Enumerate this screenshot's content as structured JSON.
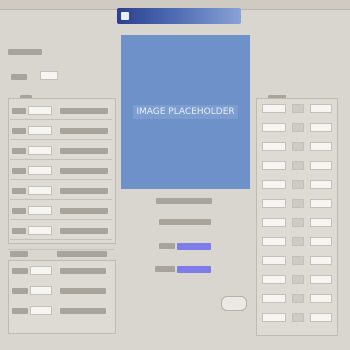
{
  "image_placeholder": {
    "label": "IMAGE PLACEHOLDER"
  },
  "left_panel": {
    "top_rows": 7,
    "bottom_rows": 3
  },
  "right_panel": {
    "rows": 12
  },
  "colors": {
    "window_bg": "#d9d6cf",
    "title_gradient_start": "#2c3f8e",
    "image_fill": "#6d91c8",
    "link": "#7e7ce8"
  }
}
